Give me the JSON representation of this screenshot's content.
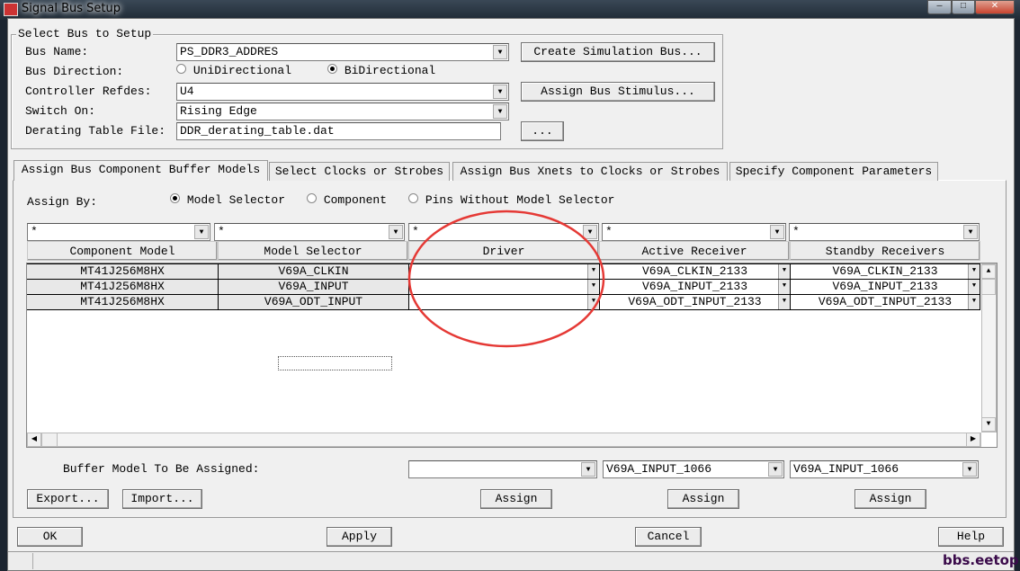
{
  "window": {
    "title": "Signal Bus Setup",
    "watermark": "bbs.eetop.cn"
  },
  "setup": {
    "group_title": "Select Bus to Setup",
    "bus_name_label": "Bus Name:",
    "bus_name": "PS_DDR3_ADDRES",
    "direction_label": "Bus Direction:",
    "dir_uni": "UniDirectional",
    "dir_bi": "BiDirectional",
    "direction_selected": "BiDirectional",
    "controller_label": "Controller Refdes:",
    "controller": "U4",
    "switch_label": "Switch On:",
    "switch": "Rising Edge",
    "derating_label": "Derating Table File:",
    "derating": "DDR_derating_table.dat",
    "create_btn": "Create Simulation Bus...",
    "stimulus_btn": "Assign Bus Stimulus...",
    "browse_btn": "..."
  },
  "tabs": [
    "Assign Bus Component Buffer Models",
    "Select Clocks or Strobes",
    "Assign Bus Xnets to Clocks or Strobes",
    "Specify Component Parameters"
  ],
  "assign_by": {
    "label": "Assign By:",
    "options": [
      "Model Selector",
      "Component",
      "Pins Without Model Selector"
    ],
    "selected": "Model Selector"
  },
  "filters": [
    "*",
    "*",
    "*",
    "*",
    "*"
  ],
  "columns": [
    "Component Model",
    "Model Selector",
    "Driver",
    "Active Receiver",
    "Standby Receivers"
  ],
  "rows": [
    [
      "MT41J256M8HX",
      "V69A_CLKIN",
      "",
      "V69A_CLKIN_2133",
      "V69A_CLKIN_2133"
    ],
    [
      "MT41J256M8HX",
      "V69A_INPUT",
      "",
      "V69A_INPUT_2133",
      "V69A_INPUT_2133"
    ],
    [
      "MT41J256M8HX",
      "V69A_ODT_INPUT",
      "",
      "V69A_ODT_INPUT_2133",
      "V69A_ODT_INPUT_2133"
    ]
  ],
  "buffer": {
    "label": "Buffer Model To Be Assigned:",
    "driver": "",
    "active": "V69A_INPUT_1066",
    "standby": "V69A_INPUT_1066"
  },
  "buttons": {
    "export": "Export...",
    "import": "Import...",
    "assign": "Assign",
    "ok": "OK",
    "apply": "Apply",
    "cancel": "Cancel",
    "help": "Help"
  },
  "colors": {
    "annotation_circle": "#e53935"
  }
}
